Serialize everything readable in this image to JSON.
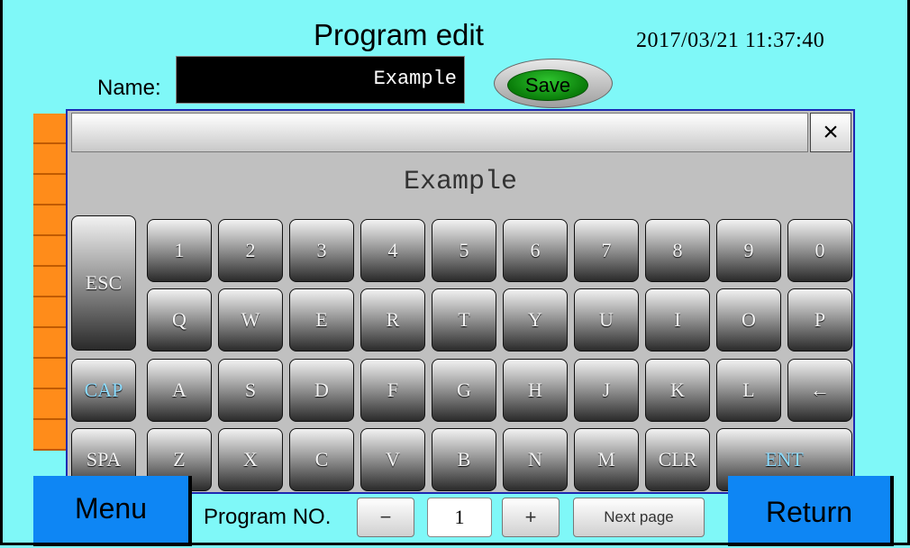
{
  "header": {
    "title": "Program edit",
    "datetime": "2017/03/21 11:37:40"
  },
  "name": {
    "label": "Name:",
    "value": "Example",
    "save_label": "Save"
  },
  "keyboard": {
    "display_text": "Example",
    "close_symbol": "×",
    "rows": [
      [
        "1",
        "2",
        "3",
        "4",
        "5",
        "6",
        "7",
        "8",
        "9",
        "0"
      ],
      [
        "Q",
        "W",
        "E",
        "R",
        "T",
        "Y",
        "U",
        "I",
        "O",
        "P"
      ],
      [
        "A",
        "S",
        "D",
        "F",
        "G",
        "H",
        "J",
        "K",
        "L",
        "←"
      ],
      [
        "Z",
        "X",
        "C",
        "V",
        "B",
        "N",
        "M",
        "CLR"
      ]
    ],
    "esc": "ESC",
    "cap": "CAP",
    "spa": "SPA",
    "ent": "ENT"
  },
  "footer": {
    "menu_label": "Menu",
    "return_label": "Return",
    "program_no_label": "Program NO.",
    "minus_label": "−",
    "plus_label": "+",
    "program_no_value": "1",
    "next_page_label": "Next page"
  },
  "colors": {
    "background": "#7ff8f8",
    "button_blue": "#0e86f4",
    "save_green": "#1aa81a",
    "strip_orange": "#ff8c1a",
    "keyboard_border": "#1e2ab2"
  },
  "icons": {
    "close": "close-icon",
    "backspace": "arrow-left-icon"
  }
}
